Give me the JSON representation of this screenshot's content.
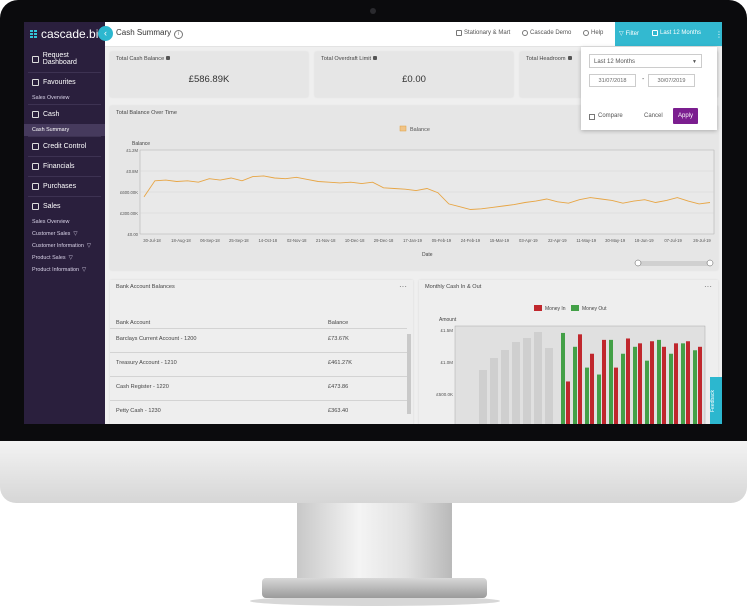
{
  "app": {
    "logo_text": "cascade.bi"
  },
  "sidebar": {
    "items": [
      {
        "label": "Request Dashboard",
        "icon": "dashboard-icon"
      },
      {
        "label": "Favourites",
        "icon": "star-icon"
      },
      {
        "label": "Sales Overview",
        "sub": true
      },
      {
        "label": "Cash",
        "icon": "cash-icon"
      },
      {
        "label": "Cash Summary",
        "sub": true,
        "active": true
      },
      {
        "label": "Credit Control",
        "icon": "credit-icon"
      },
      {
        "label": "Financials",
        "icon": "financials-icon"
      },
      {
        "label": "Purchases",
        "icon": "cart-icon"
      },
      {
        "label": "Sales",
        "icon": "sales-icon"
      },
      {
        "label": "Sales Overview",
        "sub": true
      },
      {
        "label": "Customer Sales",
        "sub": true,
        "filter": true
      },
      {
        "label": "Customer Information",
        "sub": true,
        "filter": true
      },
      {
        "label": "Product Sales",
        "sub": true,
        "filter": true
      },
      {
        "label": "Product Information",
        "sub": true,
        "filter": true
      }
    ]
  },
  "header": {
    "title": "Cash Summary",
    "company": "Stationary & Mart",
    "user": "Cascade Demo",
    "help": "Help",
    "filter": "Filter",
    "period": "Last 12 Months"
  },
  "kpis": [
    {
      "title": "Total Cash Balance",
      "value": "£586.89K"
    },
    {
      "title": "Total Overdraft Limit",
      "value": "£0.00"
    },
    {
      "title": "Total Headroom",
      "value": ""
    }
  ],
  "filter_panel": {
    "select": "Last 12 Months",
    "from": "31/07/2018",
    "to": "30/07/2019",
    "compare": "Compare",
    "cancel": "Cancel",
    "apply": "Apply"
  },
  "balance_chart": {
    "title": "Total Balance Over Time",
    "legend": "Balance",
    "ylabel": "Balance",
    "xlabel": "Date",
    "y_ticks": [
      "£1.2M",
      "£0.8M",
      "£600.00K",
      "£300.00K",
      "£0.00"
    ],
    "x_ticks": [
      "30-Jul-18",
      "18-Aug-18",
      "06-Sep-18",
      "25-Sep-18",
      "14-Oct-18",
      "02-Nov-18",
      "21-Nov-18",
      "10-Dec-18",
      "29-Dec-18",
      "17-Jan-19",
      "05-Feb-19",
      "24-Feb-19",
      "15-Mar-19",
      "03-Apr-19",
      "22-Apr-19",
      "11-May-19",
      "30-May-19",
      "18-Jun-19",
      "07-Jul-19",
      "26-Jul-19"
    ]
  },
  "accounts": {
    "title": "Bank Account Balances",
    "col_account": "Bank Account",
    "col_balance": "Balance",
    "rows": [
      {
        "account": "Barclays Current Account - 1200",
        "balance": "£73.67K"
      },
      {
        "account": "Treasury Account - 1210",
        "balance": "£461.27K"
      },
      {
        "account": "Cash Register - 1220",
        "balance": "£473.86"
      },
      {
        "account": "Petty Cash - 1230",
        "balance": "£363.40"
      }
    ]
  },
  "monthly_chart": {
    "title": "Monthly Cash In & Out",
    "legend_in": "Money In",
    "legend_out": "Money Out",
    "ylabel": "Amount",
    "y_ticks": [
      "£1.5M",
      "£1.0M",
      "£500.0K"
    ]
  },
  "feedback": "Feedback",
  "chart_data": [
    {
      "type": "line",
      "title": "Total Balance Over Time",
      "xlabel": "Date",
      "ylabel": "Balance",
      "series": [
        {
          "name": "Balance",
          "values": [
            530,
            760,
            770,
            750,
            760,
            740,
            790,
            770,
            800,
            760,
            820,
            830,
            800,
            790,
            810,
            780,
            750,
            740,
            730,
            740,
            720,
            740,
            660,
            650,
            640,
            620,
            650,
            590,
            430,
            390,
            350,
            360,
            380,
            400,
            420,
            450,
            470,
            500,
            460,
            440,
            490,
            520,
            500,
            480,
            440,
            470,
            490,
            450,
            480,
            520,
            470,
            430,
            450
          ]
        }
      ],
      "ylim": [
        0,
        1200000
      ]
    },
    {
      "type": "bar",
      "title": "Monthly Cash In & Out",
      "ylabel": "Amount",
      "series": [
        {
          "name": "Money In",
          "values": [
            700,
            1380,
            1100,
            1300,
            900,
            1320,
            1250,
            1280,
            1200,
            1250,
            1280,
            1200
          ]
        },
        {
          "name": "Money Out",
          "values": [
            1400,
            1200,
            900,
            800,
            1300,
            1100,
            1200,
            1000,
            1300,
            1100,
            1250,
            1150
          ]
        }
      ],
      "ylim": [
        0,
        1500000
      ]
    }
  ]
}
